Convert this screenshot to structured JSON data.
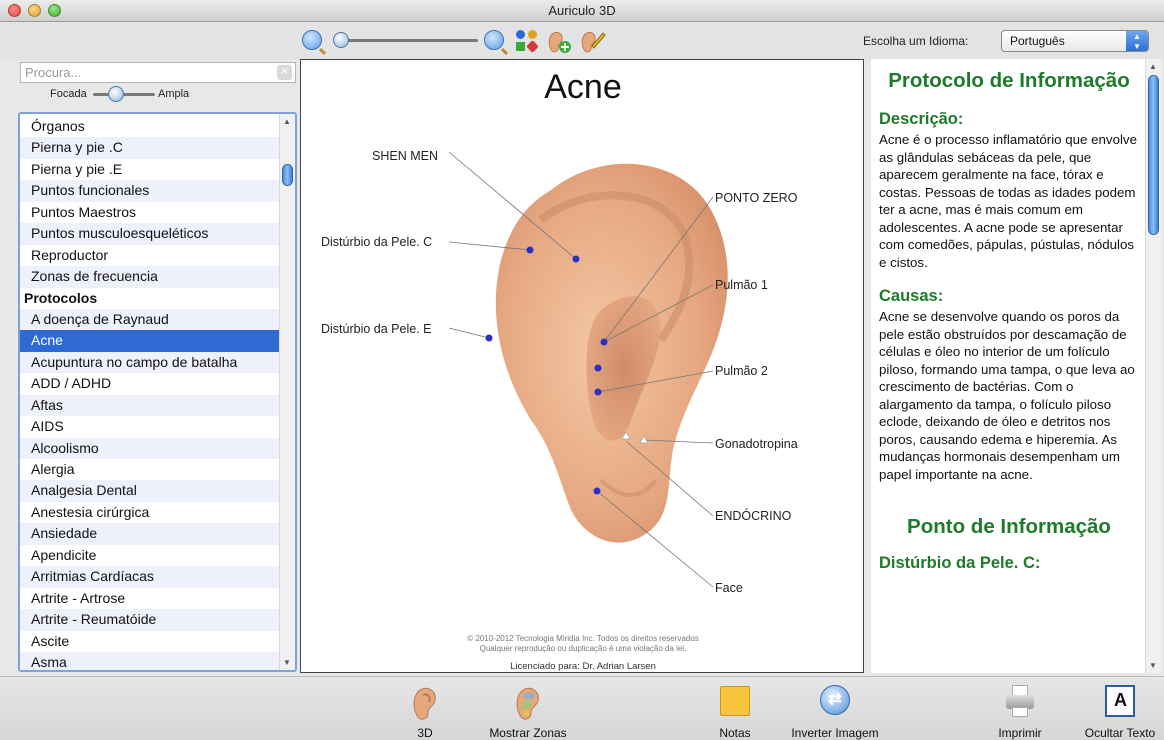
{
  "window": {
    "title": "Auriculo 3D"
  },
  "toolbar": {
    "language_label": "Escolha um Idioma:",
    "language_value": "Português"
  },
  "sidebar": {
    "search_placeholder": "Procura...",
    "focus_left": "Focada",
    "focus_right": "Ampla",
    "items": [
      {
        "label": "Órganos",
        "type": "item"
      },
      {
        "label": "Pierna y pie .C",
        "type": "item"
      },
      {
        "label": "Pierna y pie .E",
        "type": "item"
      },
      {
        "label": "Puntos funcionales",
        "type": "item"
      },
      {
        "label": "Puntos Maestros",
        "type": "item"
      },
      {
        "label": "Puntos musculoesqueléticos",
        "type": "item"
      },
      {
        "label": "Reproductor",
        "type": "item"
      },
      {
        "label": "Zonas de frecuencia",
        "type": "item"
      },
      {
        "label": "Protocolos",
        "type": "header"
      },
      {
        "label": "A doença de Raynaud",
        "type": "item"
      },
      {
        "label": "Acne",
        "type": "selected"
      },
      {
        "label": "Acupuntura no campo de batalha",
        "type": "item"
      },
      {
        "label": "ADD / ADHD",
        "type": "item"
      },
      {
        "label": "Aftas",
        "type": "item"
      },
      {
        "label": "AIDS",
        "type": "item"
      },
      {
        "label": "Alcoolismo",
        "type": "item"
      },
      {
        "label": "Alergia",
        "type": "item"
      },
      {
        "label": "Analgesia Dental",
        "type": "item"
      },
      {
        "label": "Anestesia cirúrgica",
        "type": "item"
      },
      {
        "label": "Ansiedade",
        "type": "item"
      },
      {
        "label": "Apendicite",
        "type": "item"
      },
      {
        "label": "Arritmias Cardíacas",
        "type": "item"
      },
      {
        "label": "Artrite - Artrose",
        "type": "item"
      },
      {
        "label": "Artrite - Reumatóide",
        "type": "item"
      },
      {
        "label": "Ascite",
        "type": "item"
      },
      {
        "label": "Asma",
        "type": "item"
      }
    ]
  },
  "diagram": {
    "title": "Acne",
    "labels": {
      "shen_men": "SHEN MEN",
      "ponto_zero": "PONTO ZERO",
      "disturbio_c": "Distúrbio da Pele. C",
      "pulmao1": "Pulmão 1",
      "disturbio_e": "Distúrbio da Pele. E",
      "pulmao2": "Pulmão 2",
      "gonadotropina": "Gonadotropina",
      "endocrino": "ENDÓCRINO",
      "face": "Face"
    },
    "copyright_line1": "© 2010-2012 Tecnologia Miridia Inc. Todos os direitos reservados",
    "copyright_line2": "Qualquer reprodução ou duplicação é uma violação da lei.",
    "license": "Licenciado para: Dr. Adrian Larsen"
  },
  "info": {
    "title": "Protocolo de Informação",
    "desc_heading": "Descrição:",
    "desc_text": "Acne é o processo inflamatório que envolve as glândulas sebáceas da pele, que aparecem geralmente na face, tórax e costas. Pessoas de todas as idades podem ter a acne, mas é mais comum em adolescentes. A acne pode se apresentar com comedões, pápulas, pústulas, nódulos e cistos.",
    "causes_heading": "Causas:",
    "causes_text": "Acne se desenvolve quando os poros da pele estão obstruídos por descamação de células e óleo no interior de um folículo piloso, formando uma tampa, o que leva ao crescimento de bactérias. Com o alargamento da tampa, o folículo piloso eclode, deixando de óleo e detritos nos poros, causando edema e hiperemia. As mudanças hormonais desempenham um papel importante na acne.",
    "point_title": "Ponto de Informação",
    "point_heading": "Distúrbio da Pele. C:"
  },
  "bottombar": {
    "btn_3d": "3D",
    "btn_zones": "Mostrar Zonas",
    "btn_notes": "Notas",
    "btn_invert": "Inverter Imagem",
    "btn_print": "Imprimir",
    "btn_hide": "Ocultar Texto"
  },
  "colors": {
    "selection": "#2f6ad3",
    "heading_green": "#1f7a2a",
    "point_blue": "#2a2fc8"
  }
}
